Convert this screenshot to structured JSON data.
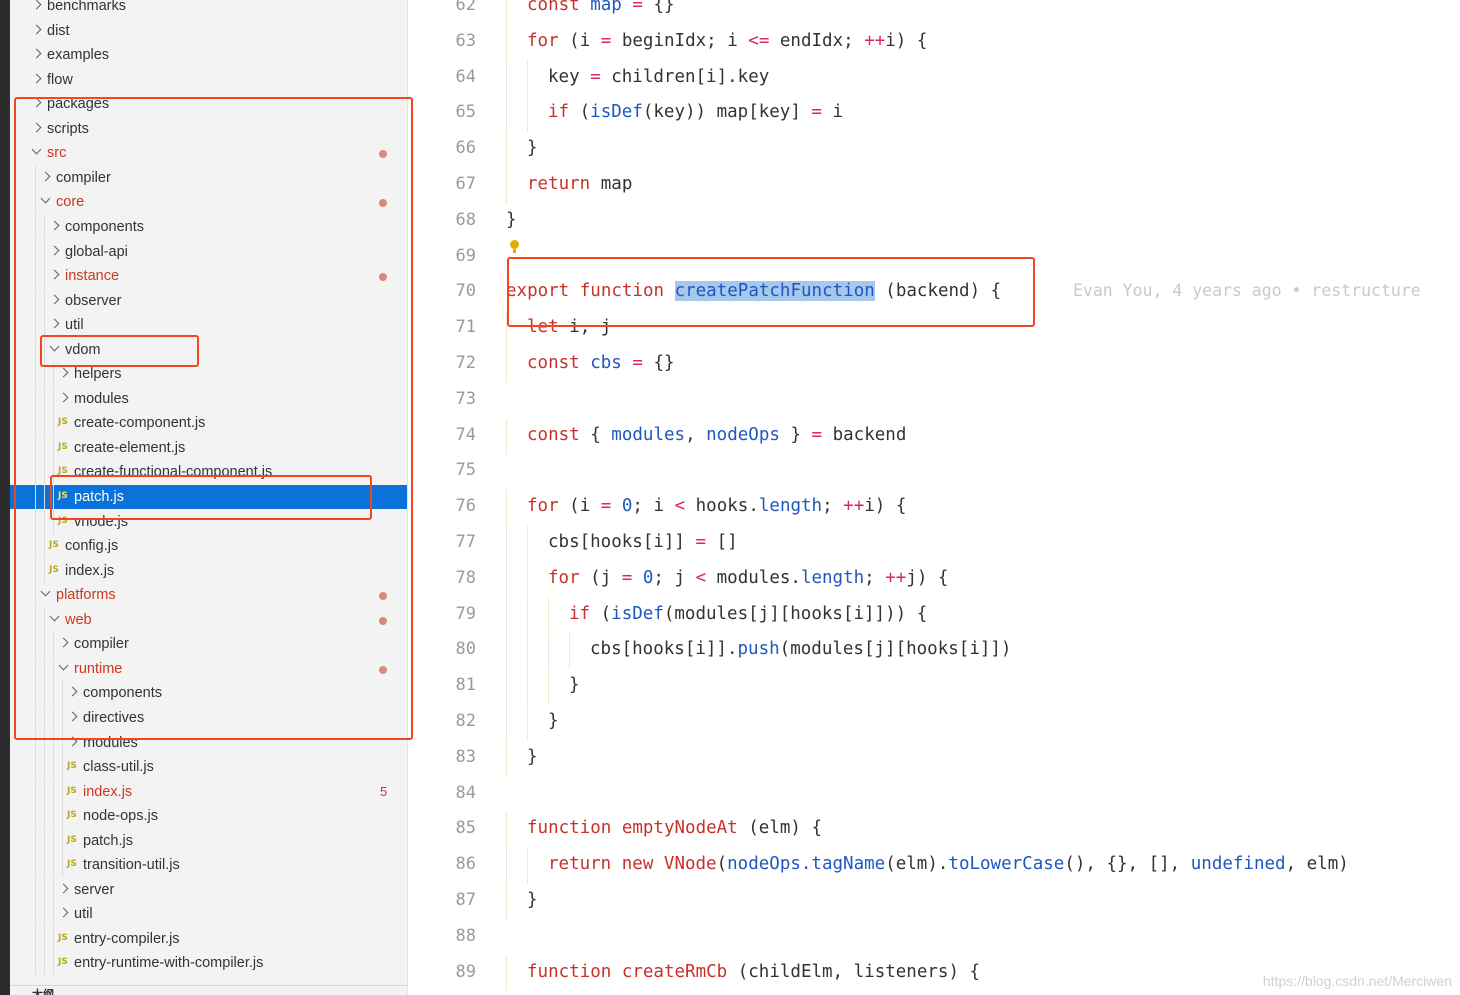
{
  "explorer": {
    "rows": [
      {
        "label": "benchmarks",
        "depth": 0,
        "kind": "folder",
        "expanded": false,
        "modified": false
      },
      {
        "label": "dist",
        "depth": 0,
        "kind": "folder",
        "expanded": false,
        "modified": false
      },
      {
        "label": "examples",
        "depth": 0,
        "kind": "folder",
        "expanded": false,
        "modified": false
      },
      {
        "label": "flow",
        "depth": 0,
        "kind": "folder",
        "expanded": false,
        "modified": false
      },
      {
        "label": "packages",
        "depth": 0,
        "kind": "folder",
        "expanded": false,
        "modified": false
      },
      {
        "label": "scripts",
        "depth": 0,
        "kind": "folder",
        "expanded": false,
        "modified": false
      },
      {
        "label": "src",
        "depth": 0,
        "kind": "folder",
        "expanded": true,
        "modified": true,
        "dot": true
      },
      {
        "label": "compiler",
        "depth": 1,
        "kind": "folder",
        "expanded": false,
        "modified": false
      },
      {
        "label": "core",
        "depth": 1,
        "kind": "folder",
        "expanded": true,
        "modified": true,
        "dot": true
      },
      {
        "label": "components",
        "depth": 2,
        "kind": "folder",
        "expanded": false,
        "modified": false
      },
      {
        "label": "global-api",
        "depth": 2,
        "kind": "folder",
        "expanded": false,
        "modified": false
      },
      {
        "label": "instance",
        "depth": 2,
        "kind": "folder",
        "expanded": false,
        "modified": true,
        "dot": true
      },
      {
        "label": "observer",
        "depth": 2,
        "kind": "folder",
        "expanded": false,
        "modified": false
      },
      {
        "label": "util",
        "depth": 2,
        "kind": "folder",
        "expanded": false,
        "modified": false
      },
      {
        "label": "vdom",
        "depth": 2,
        "kind": "folder",
        "expanded": true,
        "modified": false
      },
      {
        "label": "helpers",
        "depth": 3,
        "kind": "folder",
        "expanded": false,
        "modified": false
      },
      {
        "label": "modules",
        "depth": 3,
        "kind": "folder",
        "expanded": false,
        "modified": false
      },
      {
        "label": "create-component.js",
        "depth": 3,
        "kind": "file",
        "modified": false
      },
      {
        "label": "create-element.js",
        "depth": 3,
        "kind": "file",
        "modified": false
      },
      {
        "label": "create-functional-component.js",
        "depth": 3,
        "kind": "file",
        "modified": false
      },
      {
        "label": "patch.js",
        "depth": 3,
        "kind": "file",
        "modified": false,
        "selected": true
      },
      {
        "label": "vnode.js",
        "depth": 3,
        "kind": "file",
        "modified": false
      },
      {
        "label": "config.js",
        "depth": 2,
        "kind": "file",
        "modified": false
      },
      {
        "label": "index.js",
        "depth": 2,
        "kind": "file",
        "modified": false
      },
      {
        "label": "platforms",
        "depth": 1,
        "kind": "folder",
        "expanded": true,
        "modified": true,
        "dot": true
      },
      {
        "label": "web",
        "depth": 2,
        "kind": "folder",
        "expanded": true,
        "modified": true,
        "dot": true
      },
      {
        "label": "compiler",
        "depth": 3,
        "kind": "folder",
        "expanded": false,
        "modified": false
      },
      {
        "label": "runtime",
        "depth": 3,
        "kind": "folder",
        "expanded": true,
        "modified": true,
        "dot": true
      },
      {
        "label": "components",
        "depth": 4,
        "kind": "folder",
        "expanded": false,
        "modified": false
      },
      {
        "label": "directives",
        "depth": 4,
        "kind": "folder",
        "expanded": false,
        "modified": false
      },
      {
        "label": "modules",
        "depth": 4,
        "kind": "folder",
        "expanded": false,
        "modified": false
      },
      {
        "label": "class-util.js",
        "depth": 4,
        "kind": "file",
        "modified": false
      },
      {
        "label": "index.js",
        "depth": 4,
        "kind": "file",
        "modified": true,
        "badge": "5"
      },
      {
        "label": "node-ops.js",
        "depth": 4,
        "kind": "file",
        "modified": false
      },
      {
        "label": "patch.js",
        "depth": 4,
        "kind": "file",
        "modified": false
      },
      {
        "label": "transition-util.js",
        "depth": 4,
        "kind": "file",
        "modified": false
      },
      {
        "label": "server",
        "depth": 3,
        "kind": "folder",
        "expanded": false,
        "modified": false
      },
      {
        "label": "util",
        "depth": 3,
        "kind": "folder",
        "expanded": false,
        "modified": false
      },
      {
        "label": "entry-compiler.js",
        "depth": 3,
        "kind": "file",
        "modified": false
      },
      {
        "label": "entry-runtime-with-compiler.js",
        "depth": 3,
        "kind": "file",
        "modified": false
      }
    ],
    "file_icon_text": "JS",
    "outline_label": "大纲"
  },
  "editor": {
    "lines": [
      {
        "num": "62",
        "indent": 1,
        "tokens": [
          [
            "kw",
            "const "
          ],
          [
            "var",
            "map"
          ],
          [
            "op",
            " = "
          ],
          [
            "",
            "{}"
          ]
        ]
      },
      {
        "num": "63",
        "indent": 1,
        "tokens": [
          [
            "kw",
            "for "
          ],
          [
            "",
            "(i "
          ],
          [
            "op",
            "="
          ],
          [
            "",
            " beginIdx; i "
          ],
          [
            "op",
            "<="
          ],
          [
            "",
            " endIdx; "
          ],
          [
            "op",
            "++"
          ],
          [
            "",
            "i) {"
          ]
        ]
      },
      {
        "num": "64",
        "indent": 2,
        "tokens": [
          [
            "",
            "key "
          ],
          [
            "op",
            "="
          ],
          [
            "",
            " children[i].key"
          ]
        ]
      },
      {
        "num": "65",
        "indent": 2,
        "tokens": [
          [
            "kw",
            "if "
          ],
          [
            "",
            "("
          ],
          [
            "fn",
            "isDef"
          ],
          [
            "",
            "(key)) map[key] "
          ],
          [
            "op",
            "="
          ],
          [
            "",
            " i"
          ]
        ]
      },
      {
        "num": "66",
        "indent": 1,
        "tokens": [
          [
            "",
            "}"
          ]
        ]
      },
      {
        "num": "67",
        "indent": 1,
        "tokens": [
          [
            "kw",
            "return "
          ],
          [
            "",
            "map"
          ]
        ]
      },
      {
        "num": "68",
        "indent": 0,
        "tokens": [
          [
            "",
            "}"
          ]
        ]
      },
      {
        "num": "69",
        "indent": 0,
        "tokens": []
      },
      {
        "num": "70",
        "indent": 0,
        "tokens": [
          [
            "kw",
            "export function "
          ],
          [
            "hlfn",
            "createPatchFunction"
          ],
          [
            "",
            " (backend) {"
          ]
        ],
        "blame": "Evan You, 4 years ago • restructure"
      },
      {
        "num": "71",
        "indent": 1,
        "tokens": [
          [
            "kw",
            "let "
          ],
          [
            "",
            "i, j"
          ]
        ]
      },
      {
        "num": "72",
        "indent": 1,
        "tokens": [
          [
            "kw",
            "const "
          ],
          [
            "var",
            "cbs"
          ],
          [
            "op",
            " = "
          ],
          [
            "",
            "{}"
          ]
        ]
      },
      {
        "num": "73",
        "indent": 0,
        "tokens": []
      },
      {
        "num": "74",
        "indent": 1,
        "tokens": [
          [
            "kw",
            "const "
          ],
          [
            "",
            "{ "
          ],
          [
            "var",
            "modules"
          ],
          [
            "",
            ", "
          ],
          [
            "var",
            "nodeOps"
          ],
          [
            "",
            " } "
          ],
          [
            "op",
            "="
          ],
          [
            "",
            " backend"
          ]
        ]
      },
      {
        "num": "75",
        "indent": 0,
        "tokens": []
      },
      {
        "num": "76",
        "indent": 1,
        "tokens": [
          [
            "kw",
            "for "
          ],
          [
            "",
            "(i "
          ],
          [
            "op",
            "="
          ],
          [
            "",
            " "
          ],
          [
            "num",
            "0"
          ],
          [
            "",
            "; i "
          ],
          [
            "op",
            "<"
          ],
          [
            "",
            " hooks."
          ],
          [
            "fn",
            "length"
          ],
          [
            "",
            "; "
          ],
          [
            "op",
            "++"
          ],
          [
            "",
            "i) {"
          ]
        ]
      },
      {
        "num": "77",
        "indent": 2,
        "tokens": [
          [
            "",
            "cbs[hooks[i]] "
          ],
          [
            "op",
            "="
          ],
          [
            "",
            " []"
          ]
        ]
      },
      {
        "num": "78",
        "indent": 2,
        "tokens": [
          [
            "kw",
            "for "
          ],
          [
            "",
            "(j "
          ],
          [
            "op",
            "="
          ],
          [
            "",
            " "
          ],
          [
            "num",
            "0"
          ],
          [
            "",
            "; j "
          ],
          [
            "op",
            "<"
          ],
          [
            "",
            " modules."
          ],
          [
            "fn",
            "length"
          ],
          [
            "",
            "; "
          ],
          [
            "op",
            "++"
          ],
          [
            "",
            "j) {"
          ]
        ]
      },
      {
        "num": "79",
        "indent": 3,
        "tokens": [
          [
            "kw",
            "if "
          ],
          [
            "",
            "("
          ],
          [
            "fn",
            "isDef"
          ],
          [
            "",
            "(modules[j][hooks[i]])) {"
          ]
        ]
      },
      {
        "num": "80",
        "indent": 4,
        "tokens": [
          [
            "",
            "cbs[hooks[i]]."
          ],
          [
            "fn",
            "push"
          ],
          [
            "",
            "(modules[j][hooks[i]])"
          ]
        ]
      },
      {
        "num": "81",
        "indent": 3,
        "tokens": [
          [
            "",
            "}"
          ]
        ]
      },
      {
        "num": "82",
        "indent": 2,
        "tokens": [
          [
            "",
            "}"
          ]
        ]
      },
      {
        "num": "83",
        "indent": 1,
        "tokens": [
          [
            "",
            "}"
          ]
        ]
      },
      {
        "num": "84",
        "indent": 0,
        "tokens": []
      },
      {
        "num": "85",
        "indent": 1,
        "tokens": [
          [
            "kw",
            "function "
          ],
          [
            "kw",
            "emptyNodeAt"
          ],
          [
            "",
            " (elm) {"
          ]
        ]
      },
      {
        "num": "86",
        "indent": 2,
        "tokens": [
          [
            "kw",
            "return new "
          ],
          [
            "kw",
            "VNode"
          ],
          [
            "",
            "("
          ],
          [
            "fn",
            "nodeOps.tagName"
          ],
          [
            "",
            "(elm)."
          ],
          [
            "fn",
            "toLowerCase"
          ],
          [
            "",
            "(), {}, [], "
          ],
          [
            "var",
            "undefined"
          ],
          [
            "",
            ", elm)"
          ]
        ]
      },
      {
        "num": "87",
        "indent": 1,
        "tokens": [
          [
            "",
            "}"
          ]
        ]
      },
      {
        "num": "88",
        "indent": 0,
        "tokens": []
      },
      {
        "num": "89",
        "indent": 1,
        "tokens": [
          [
            "kw",
            "function "
          ],
          [
            "kw",
            "createRmCb"
          ],
          [
            "",
            " (childElm, listeners) {"
          ]
        ]
      }
    ]
  },
  "watermark": "https://blog.csdn.net/Merciwen",
  "colors": {
    "annotation": "#f2461f",
    "selection": "#0a72d9",
    "keyword": "#c8312a",
    "identifier": "#1f57c2",
    "operator": "#d7266b"
  }
}
